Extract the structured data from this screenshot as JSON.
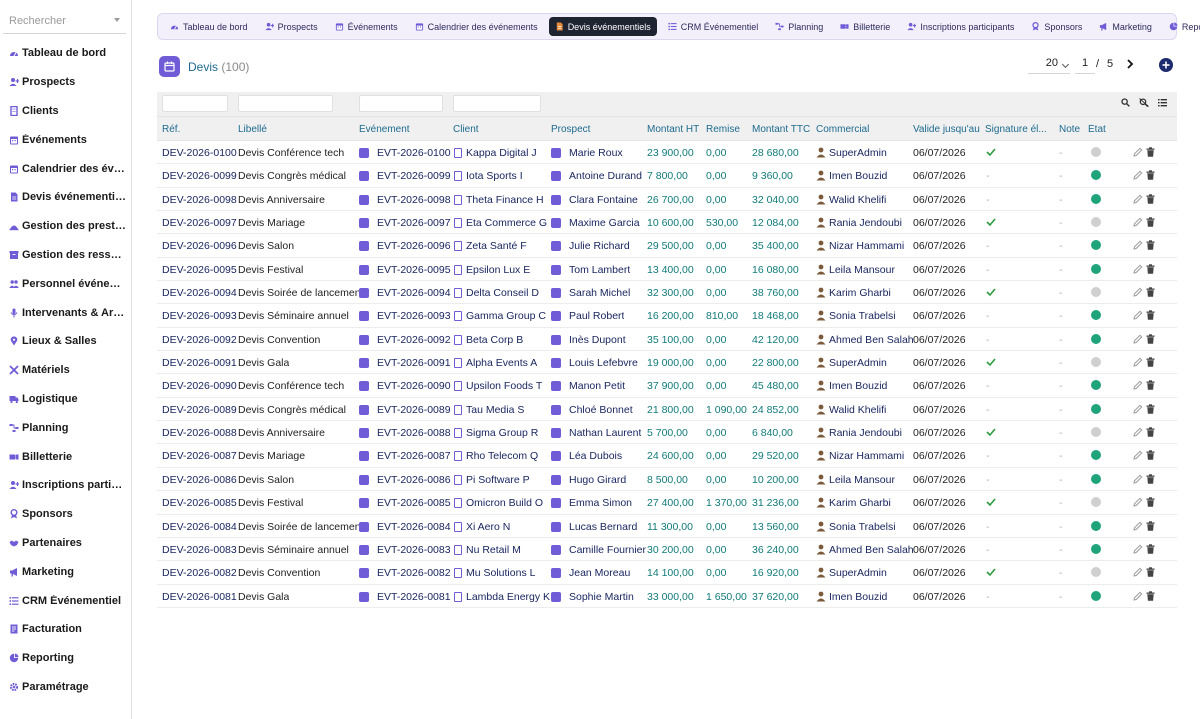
{
  "sidebar": {
    "search_placeholder": "Rechercher",
    "items": [
      {
        "label": "Tableau de bord",
        "icon": "dashboard-icon",
        "color": "#6f5cd6"
      },
      {
        "label": "Prospects",
        "icon": "user-plus-icon",
        "color": "#6f5cd6"
      },
      {
        "label": "Clients",
        "icon": "building-icon",
        "color": "#6f5cd6"
      },
      {
        "label": "Événements",
        "icon": "calendar-icon",
        "color": "#6f5cd6"
      },
      {
        "label": "Calendrier des événements",
        "icon": "calendar-icon",
        "color": "#6f5cd6"
      },
      {
        "label": "Devis événementiels",
        "icon": "document-icon",
        "color": "#6f5cd6"
      },
      {
        "label": "Gestion des prestations",
        "icon": "service-icon",
        "color": "#6f5cd6"
      },
      {
        "label": "Gestion des ressources",
        "icon": "box-icon",
        "color": "#6f5cd6"
      },
      {
        "label": "Personnel événementiel",
        "icon": "people-icon",
        "color": "#6f5cd6"
      },
      {
        "label": "Intervenants & Artistes",
        "icon": "microphone-icon",
        "color": "#6f5cd6"
      },
      {
        "label": "Lieux & Salles",
        "icon": "location-icon",
        "color": "#6f5cd6"
      },
      {
        "label": "Matériels",
        "icon": "tools-icon",
        "color": "#6f5cd6"
      },
      {
        "label": "Logistique",
        "icon": "truck-icon",
        "color": "#6f5cd6"
      },
      {
        "label": "Planning",
        "icon": "planning-icon",
        "color": "#6f5cd6"
      },
      {
        "label": "Billetterie",
        "icon": "ticket-icon",
        "color": "#6f5cd6"
      },
      {
        "label": "Inscriptions participants",
        "icon": "user-plus-icon",
        "color": "#6f5cd6"
      },
      {
        "label": "Sponsors",
        "icon": "sponsor-icon",
        "color": "#6f5cd6"
      },
      {
        "label": "Partenaires",
        "icon": "handshake-icon",
        "color": "#6f5cd6"
      },
      {
        "label": "Marketing",
        "icon": "megaphone-icon",
        "color": "#6f5cd6"
      },
      {
        "label": "CRM Événementiel",
        "icon": "list-icon",
        "color": "#6f5cd6"
      },
      {
        "label": "Facturation",
        "icon": "invoice-icon",
        "color": "#6f5cd6"
      },
      {
        "label": "Reporting",
        "icon": "pie-chart-icon",
        "color": "#6f5cd6"
      },
      {
        "label": "Paramétrage",
        "icon": "gear-icon",
        "color": "#6f5cd6"
      }
    ]
  },
  "topnav": {
    "tabs": [
      {
        "label": "Tableau de bord",
        "icon": "dashboard-icon",
        "active": false
      },
      {
        "label": "Prospects",
        "icon": "user-plus-icon",
        "active": false
      },
      {
        "label": "Événements",
        "icon": "calendar-icon",
        "active": false
      },
      {
        "label": "Calendrier des événements",
        "icon": "calendar-icon",
        "active": false
      },
      {
        "label": "Devis événementiels",
        "icon": "document-icon",
        "active": true
      },
      {
        "label": "CRM Événementiel",
        "icon": "list-icon",
        "active": false
      },
      {
        "label": "Planning",
        "icon": "planning-icon",
        "active": false
      },
      {
        "label": "Billetterie",
        "icon": "ticket-icon",
        "active": false
      },
      {
        "label": "Inscriptions participants",
        "icon": "user-plus-icon",
        "active": false
      },
      {
        "label": "Sponsors",
        "icon": "sponsor-icon",
        "active": false
      },
      {
        "label": "Marketing",
        "icon": "megaphone-icon",
        "active": false
      },
      {
        "label": "Reporting",
        "icon": "pie-chart-icon",
        "active": false
      }
    ]
  },
  "header": {
    "title": "Devis",
    "count": "(100)"
  },
  "pager": {
    "page_size": "20",
    "current_page": "1",
    "separator": "/",
    "total_pages": "5"
  },
  "table": {
    "columns": [
      "Réf.",
      "Libellé",
      "Événement",
      "Client",
      "Prospect",
      "Montant HT",
      "Remise",
      "Montant TTC",
      "Commercial",
      "Valide jusqu'au",
      "Signature él...",
      "Note",
      "État"
    ],
    "rows": [
      {
        "ref": "DEV-2026-0100",
        "libelle": "Devis Conférence tech",
        "evenement": "EVT-2026-0100",
        "client": "Kappa Digital J",
        "prospect": "Marie Roux",
        "ht": "23 900,00",
        "remise": "0,00",
        "ttc": "28 680,00",
        "commercial": "SuperAdmin",
        "valide": "06/07/2026",
        "signature": true,
        "note": "-",
        "etat": "grey"
      },
      {
        "ref": "DEV-2026-0099",
        "libelle": "Devis Congrès médical",
        "evenement": "EVT-2026-0099",
        "client": "Iota Sports I",
        "prospect": "Antoine Durand",
        "ht": "7 800,00",
        "remise": "0,00",
        "ttc": "9 360,00",
        "commercial": "Imen Bouzid",
        "valide": "06/07/2026",
        "signature": false,
        "note": "-",
        "etat": "green"
      },
      {
        "ref": "DEV-2026-0098",
        "libelle": "Devis Anniversaire",
        "evenement": "EVT-2026-0098",
        "client": "Theta Finance H",
        "prospect": "Clara Fontaine",
        "ht": "26 700,00",
        "remise": "0,00",
        "ttc": "32 040,00",
        "commercial": "Walid Khelifi",
        "valide": "06/07/2026",
        "signature": false,
        "note": "-",
        "etat": "green"
      },
      {
        "ref": "DEV-2026-0097",
        "libelle": "Devis Mariage",
        "evenement": "EVT-2026-0097",
        "client": "Eta Commerce G",
        "prospect": "Maxime Garcia",
        "ht": "10 600,00",
        "remise": "530,00",
        "ttc": "12 084,00",
        "commercial": "Rania Jendoubi",
        "valide": "06/07/2026",
        "signature": true,
        "note": "-",
        "etat": "grey"
      },
      {
        "ref": "DEV-2026-0096",
        "libelle": "Devis Salon",
        "evenement": "EVT-2026-0096",
        "client": "Zeta Santé F",
        "prospect": "Julie Richard",
        "ht": "29 500,00",
        "remise": "0,00",
        "ttc": "35 400,00",
        "commercial": "Nizar Hammami",
        "valide": "06/07/2026",
        "signature": false,
        "note": "-",
        "etat": "green"
      },
      {
        "ref": "DEV-2026-0095",
        "libelle": "Devis Festival",
        "evenement": "EVT-2026-0095",
        "client": "Epsilon Lux E",
        "prospect": "Tom Lambert",
        "ht": "13 400,00",
        "remise": "0,00",
        "ttc": "16 080,00",
        "commercial": "Leila Mansour",
        "valide": "06/07/2026",
        "signature": false,
        "note": "-",
        "etat": "green"
      },
      {
        "ref": "DEV-2026-0094",
        "libelle": "Devis Soirée de lancement",
        "evenement": "EVT-2026-0094",
        "client": "Delta Conseil D",
        "prospect": "Sarah Michel",
        "ht": "32 300,00",
        "remise": "0,00",
        "ttc": "38 760,00",
        "commercial": "Karim Gharbi",
        "valide": "06/07/2026",
        "signature": true,
        "note": "-",
        "etat": "grey"
      },
      {
        "ref": "DEV-2026-0093",
        "libelle": "Devis Séminaire annuel",
        "evenement": "EVT-2026-0093",
        "client": "Gamma Group C",
        "prospect": "Paul Robert",
        "ht": "16 200,00",
        "remise": "810,00",
        "ttc": "18 468,00",
        "commercial": "Sonia Trabelsi",
        "valide": "06/07/2026",
        "signature": false,
        "note": "-",
        "etat": "green"
      },
      {
        "ref": "DEV-2026-0092",
        "libelle": "Devis Convention",
        "evenement": "EVT-2026-0092",
        "client": "Beta Corp B",
        "prospect": "Inès Dupont",
        "ht": "35 100,00",
        "remise": "0,00",
        "ttc": "42 120,00",
        "commercial": "Ahmed Ben Salah",
        "valide": "06/07/2026",
        "signature": false,
        "note": "-",
        "etat": "green"
      },
      {
        "ref": "DEV-2026-0091",
        "libelle": "Devis Gala",
        "evenement": "EVT-2026-0091",
        "client": "Alpha Events A",
        "prospect": "Louis Lefebvre",
        "ht": "19 000,00",
        "remise": "0,00",
        "ttc": "22 800,00",
        "commercial": "SuperAdmin",
        "valide": "06/07/2026",
        "signature": true,
        "note": "-",
        "etat": "grey"
      },
      {
        "ref": "DEV-2026-0090",
        "libelle": "Devis Conférence tech",
        "evenement": "EVT-2026-0090",
        "client": "Upsilon Foods T",
        "prospect": "Manon Petit",
        "ht": "37 900,00",
        "remise": "0,00",
        "ttc": "45 480,00",
        "commercial": "Imen Bouzid",
        "valide": "06/07/2026",
        "signature": false,
        "note": "-",
        "etat": "green"
      },
      {
        "ref": "DEV-2026-0089",
        "libelle": "Devis Congrès médical",
        "evenement": "EVT-2026-0089",
        "client": "Tau Media S",
        "prospect": "Chloé Bonnet",
        "ht": "21 800,00",
        "remise": "1 090,00",
        "ttc": "24 852,00",
        "commercial": "Walid Khelifi",
        "valide": "06/07/2026",
        "signature": false,
        "note": "-",
        "etat": "green"
      },
      {
        "ref": "DEV-2026-0088",
        "libelle": "Devis Anniversaire",
        "evenement": "EVT-2026-0088",
        "client": "Sigma Group R",
        "prospect": "Nathan Laurent",
        "ht": "5 700,00",
        "remise": "0,00",
        "ttc": "6 840,00",
        "commercial": "Rania Jendoubi",
        "valide": "06/07/2026",
        "signature": true,
        "note": "-",
        "etat": "grey"
      },
      {
        "ref": "DEV-2026-0087",
        "libelle": "Devis Mariage",
        "evenement": "EVT-2026-0087",
        "client": "Rho Telecom Q",
        "prospect": "Léa Dubois",
        "ht": "24 600,00",
        "remise": "0,00",
        "ttc": "29 520,00",
        "commercial": "Nizar Hammami",
        "valide": "06/07/2026",
        "signature": false,
        "note": "-",
        "etat": "green"
      },
      {
        "ref": "DEV-2026-0086",
        "libelle": "Devis Salon",
        "evenement": "EVT-2026-0086",
        "client": "Pi Software P",
        "prospect": "Hugo Girard",
        "ht": "8 500,00",
        "remise": "0,00",
        "ttc": "10 200,00",
        "commercial": "Leila Mansour",
        "valide": "06/07/2026",
        "signature": false,
        "note": "-",
        "etat": "green"
      },
      {
        "ref": "DEV-2026-0085",
        "libelle": "Devis Festival",
        "evenement": "EVT-2026-0085",
        "client": "Omicron Build O",
        "prospect": "Emma Simon",
        "ht": "27 400,00",
        "remise": "1 370,00",
        "ttc": "31 236,00",
        "commercial": "Karim Gharbi",
        "valide": "06/07/2026",
        "signature": true,
        "note": "-",
        "etat": "grey"
      },
      {
        "ref": "DEV-2026-0084",
        "libelle": "Devis Soirée de lancement",
        "evenement": "EVT-2026-0084",
        "client": "Xi Aero N",
        "prospect": "Lucas Bernard",
        "ht": "11 300,00",
        "remise": "0,00",
        "ttc": "13 560,00",
        "commercial": "Sonia Trabelsi",
        "valide": "06/07/2026",
        "signature": false,
        "note": "-",
        "etat": "green"
      },
      {
        "ref": "DEV-2026-0083",
        "libelle": "Devis Séminaire annuel",
        "evenement": "EVT-2026-0083",
        "client": "Nu Retail M",
        "prospect": "Camille Fournier",
        "ht": "30 200,00",
        "remise": "0,00",
        "ttc": "36 240,00",
        "commercial": "Ahmed Ben Salah",
        "valide": "06/07/2026",
        "signature": false,
        "note": "-",
        "etat": "green"
      },
      {
        "ref": "DEV-2026-0082",
        "libelle": "Devis Convention",
        "evenement": "EVT-2026-0082",
        "client": "Mu Solutions L",
        "prospect": "Jean Moreau",
        "ht": "14 100,00",
        "remise": "0,00",
        "ttc": "16 920,00",
        "commercial": "SuperAdmin",
        "valide": "06/07/2026",
        "signature": true,
        "note": "-",
        "etat": "grey"
      },
      {
        "ref": "DEV-2026-0081",
        "libelle": "Devis Gala",
        "evenement": "EVT-2026-0081",
        "client": "Lambda Energy K",
        "prospect": "Sophie Martin",
        "ht": "33 000,00",
        "remise": "1 650,00",
        "ttc": "37 620,00",
        "commercial": "Imen Bouzid",
        "valide": "06/07/2026",
        "signature": false,
        "note": "-",
        "etat": "green"
      }
    ]
  },
  "colors": {
    "accent": "#6f5cd6",
    "link": "#1a2760",
    "amount": "#117a7a",
    "header_text": "#1d6b8f",
    "state_green": "#1fa37a",
    "state_grey": "#cfcfcf",
    "check": "#2e9b3d"
  }
}
